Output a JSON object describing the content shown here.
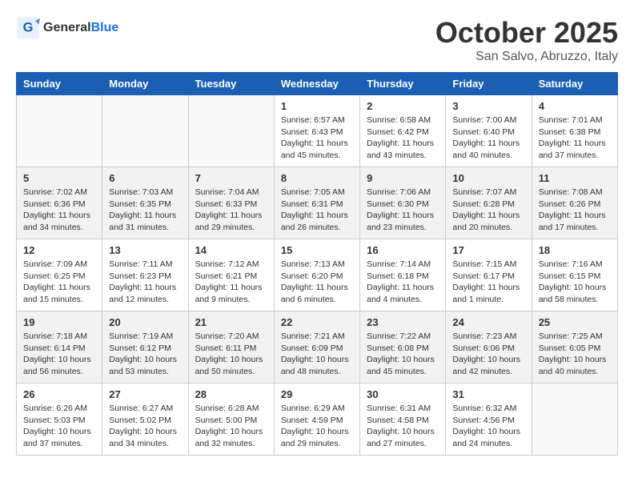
{
  "header": {
    "logo_general": "General",
    "logo_blue": "Blue",
    "month": "October 2025",
    "location": "San Salvo, Abruzzo, Italy"
  },
  "days_of_week": [
    "Sunday",
    "Monday",
    "Tuesday",
    "Wednesday",
    "Thursday",
    "Friday",
    "Saturday"
  ],
  "weeks": [
    [
      {
        "day": "",
        "info": ""
      },
      {
        "day": "",
        "info": ""
      },
      {
        "day": "",
        "info": ""
      },
      {
        "day": "1",
        "info": "Sunrise: 6:57 AM\nSunset: 6:43 PM\nDaylight: 11 hours and 45 minutes."
      },
      {
        "day": "2",
        "info": "Sunrise: 6:58 AM\nSunset: 6:42 PM\nDaylight: 11 hours and 43 minutes."
      },
      {
        "day": "3",
        "info": "Sunrise: 7:00 AM\nSunset: 6:40 PM\nDaylight: 11 hours and 40 minutes."
      },
      {
        "day": "4",
        "info": "Sunrise: 7:01 AM\nSunset: 6:38 PM\nDaylight: 11 hours and 37 minutes."
      }
    ],
    [
      {
        "day": "5",
        "info": "Sunrise: 7:02 AM\nSunset: 6:36 PM\nDaylight: 11 hours and 34 minutes."
      },
      {
        "day": "6",
        "info": "Sunrise: 7:03 AM\nSunset: 6:35 PM\nDaylight: 11 hours and 31 minutes."
      },
      {
        "day": "7",
        "info": "Sunrise: 7:04 AM\nSunset: 6:33 PM\nDaylight: 11 hours and 29 minutes."
      },
      {
        "day": "8",
        "info": "Sunrise: 7:05 AM\nSunset: 6:31 PM\nDaylight: 11 hours and 26 minutes."
      },
      {
        "day": "9",
        "info": "Sunrise: 7:06 AM\nSunset: 6:30 PM\nDaylight: 11 hours and 23 minutes."
      },
      {
        "day": "10",
        "info": "Sunrise: 7:07 AM\nSunset: 6:28 PM\nDaylight: 11 hours and 20 minutes."
      },
      {
        "day": "11",
        "info": "Sunrise: 7:08 AM\nSunset: 6:26 PM\nDaylight: 11 hours and 17 minutes."
      }
    ],
    [
      {
        "day": "12",
        "info": "Sunrise: 7:09 AM\nSunset: 6:25 PM\nDaylight: 11 hours and 15 minutes."
      },
      {
        "day": "13",
        "info": "Sunrise: 7:11 AM\nSunset: 6:23 PM\nDaylight: 11 hours and 12 minutes."
      },
      {
        "day": "14",
        "info": "Sunrise: 7:12 AM\nSunset: 6:21 PM\nDaylight: 11 hours and 9 minutes."
      },
      {
        "day": "15",
        "info": "Sunrise: 7:13 AM\nSunset: 6:20 PM\nDaylight: 11 hours and 6 minutes."
      },
      {
        "day": "16",
        "info": "Sunrise: 7:14 AM\nSunset: 6:18 PM\nDaylight: 11 hours and 4 minutes."
      },
      {
        "day": "17",
        "info": "Sunrise: 7:15 AM\nSunset: 6:17 PM\nDaylight: 11 hours and 1 minute."
      },
      {
        "day": "18",
        "info": "Sunrise: 7:16 AM\nSunset: 6:15 PM\nDaylight: 10 hours and 58 minutes."
      }
    ],
    [
      {
        "day": "19",
        "info": "Sunrise: 7:18 AM\nSunset: 6:14 PM\nDaylight: 10 hours and 56 minutes."
      },
      {
        "day": "20",
        "info": "Sunrise: 7:19 AM\nSunset: 6:12 PM\nDaylight: 10 hours and 53 minutes."
      },
      {
        "day": "21",
        "info": "Sunrise: 7:20 AM\nSunset: 6:11 PM\nDaylight: 10 hours and 50 minutes."
      },
      {
        "day": "22",
        "info": "Sunrise: 7:21 AM\nSunset: 6:09 PM\nDaylight: 10 hours and 48 minutes."
      },
      {
        "day": "23",
        "info": "Sunrise: 7:22 AM\nSunset: 6:08 PM\nDaylight: 10 hours and 45 minutes."
      },
      {
        "day": "24",
        "info": "Sunrise: 7:23 AM\nSunset: 6:06 PM\nDaylight: 10 hours and 42 minutes."
      },
      {
        "day": "25",
        "info": "Sunrise: 7:25 AM\nSunset: 6:05 PM\nDaylight: 10 hours and 40 minutes."
      }
    ],
    [
      {
        "day": "26",
        "info": "Sunrise: 6:26 AM\nSunset: 5:03 PM\nDaylight: 10 hours and 37 minutes."
      },
      {
        "day": "27",
        "info": "Sunrise: 6:27 AM\nSunset: 5:02 PM\nDaylight: 10 hours and 34 minutes."
      },
      {
        "day": "28",
        "info": "Sunrise: 6:28 AM\nSunset: 5:00 PM\nDaylight: 10 hours and 32 minutes."
      },
      {
        "day": "29",
        "info": "Sunrise: 6:29 AM\nSunset: 4:59 PM\nDaylight: 10 hours and 29 minutes."
      },
      {
        "day": "30",
        "info": "Sunrise: 6:31 AM\nSunset: 4:58 PM\nDaylight: 10 hours and 27 minutes."
      },
      {
        "day": "31",
        "info": "Sunrise: 6:32 AM\nSunset: 4:56 PM\nDaylight: 10 hours and 24 minutes."
      },
      {
        "day": "",
        "info": ""
      }
    ]
  ]
}
